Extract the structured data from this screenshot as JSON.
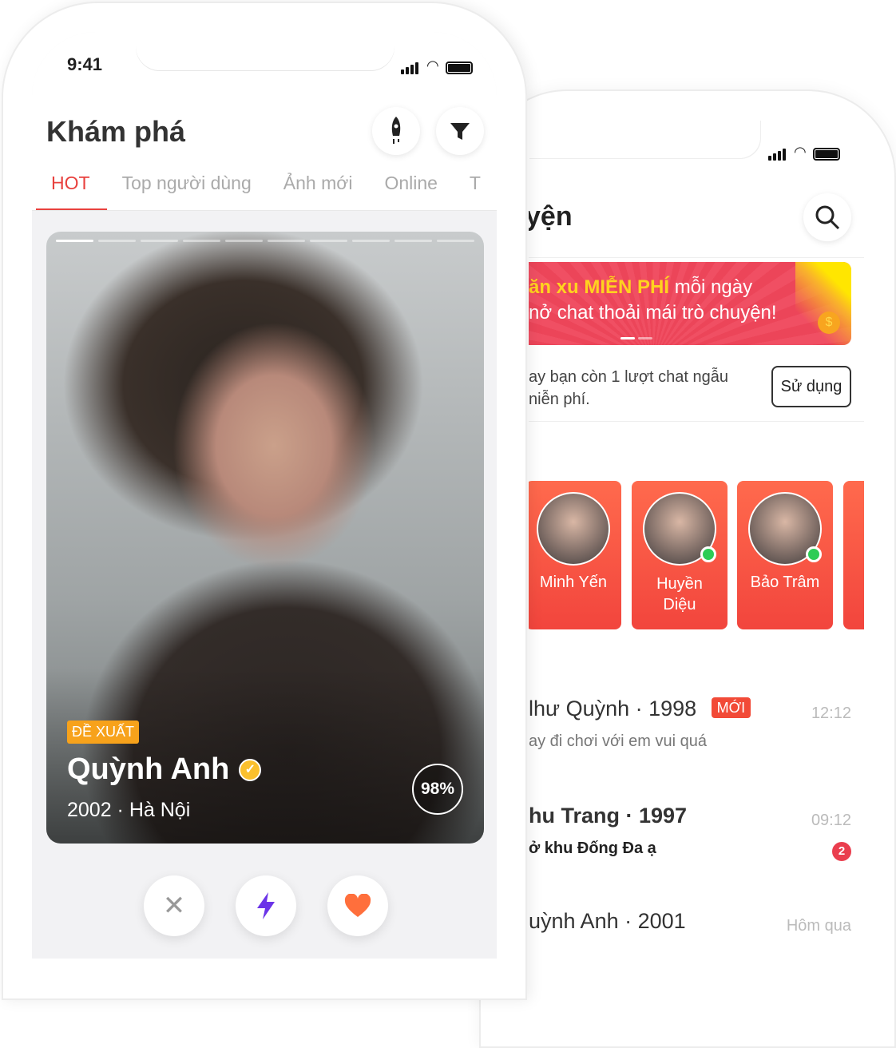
{
  "discover": {
    "status_time": "9:41",
    "title": "Khám phá",
    "tabs": [
      "HOT",
      "Top người dùng",
      "Ảnh mới",
      "Online",
      "T"
    ],
    "card": {
      "badge": "ĐỀ XUẤT",
      "name": "Quỳnh Anh",
      "info": "2002 · Hà Nội",
      "match": "98%",
      "photo_index": 1,
      "photo_count": 10
    },
    "icons": {
      "boost": "rocket-icon",
      "filter": "filter-icon",
      "dislike": "close-icon",
      "super": "lightning-icon",
      "like": "heart-icon"
    },
    "accent": "#e8413e"
  },
  "chat": {
    "title": "yện",
    "banner": {
      "line1_highlight": "ăn xu MIỄN PHÍ",
      "line1_rest": " mỗi ngày",
      "line2": "nở chat thoải mái trò chuyện!"
    },
    "free_notice": {
      "line1": "ay bạn còn 1 lượt chat ngẫu",
      "line2": "niễn phí.",
      "button": "Sử dụng"
    },
    "stories": [
      {
        "name": "Minh Yến",
        "online": false
      },
      {
        "name": "Huyền Diệu",
        "online": true
      },
      {
        "name": "Bảo Trâm",
        "online": true
      }
    ],
    "conversations": [
      {
        "name": "lhư Quỳnh · 1998",
        "badge": "MỚI",
        "message": "ay đi chơi với em vui quá",
        "time": "12:12",
        "bold": false
      },
      {
        "name": "hu Trang · 1997",
        "message": "ở khu Đống Đa ạ",
        "time": "09:12",
        "unread": "2",
        "bold": true
      },
      {
        "name": "uỳnh Anh · 2001",
        "message": "",
        "time": "Hôm qua",
        "bold": false
      }
    ]
  }
}
